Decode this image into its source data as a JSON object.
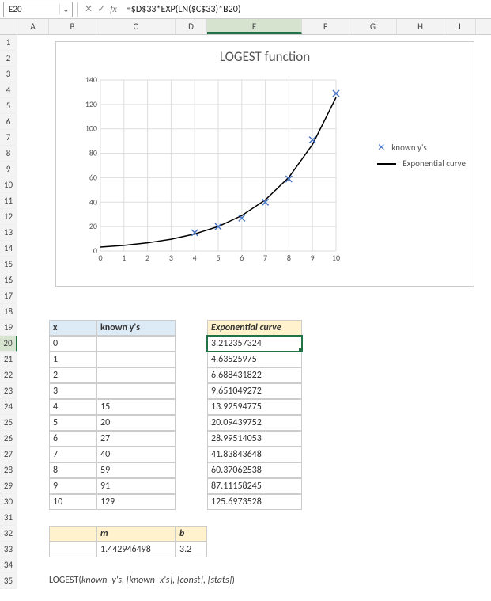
{
  "formula_bar": {
    "cell_ref": "E20",
    "formula": "=$D$33*EXP(LN($C$33)*B20)"
  },
  "columns": [
    "A",
    "B",
    "C",
    "D",
    "E",
    "F",
    "G",
    "H",
    "I"
  ],
  "column_widths": {
    "A": 40,
    "B": 60,
    "C": 100,
    "D": 40,
    "E": 120,
    "F": 60,
    "G": 60,
    "H": 60,
    "I": 40
  },
  "selected_column": "E",
  "selected_row": 20,
  "row_count": 35,
  "chart_data": {
    "type": "scatter+line",
    "title": "LOGEST function",
    "xlabel": "",
    "ylabel": "",
    "xlim": [
      0,
      10
    ],
    "ylim": [
      0,
      140
    ],
    "xticks": [
      0,
      1,
      2,
      3,
      4,
      5,
      6,
      7,
      8,
      9,
      10
    ],
    "yticks": [
      0,
      20,
      40,
      60,
      80,
      100,
      120,
      140
    ],
    "series": [
      {
        "name": "known y's",
        "type": "scatter",
        "marker": "x",
        "color": "#4472C4",
        "x": [
          4,
          5,
          6,
          7,
          8,
          9,
          10
        ],
        "y": [
          15,
          20,
          27,
          40,
          59,
          91,
          129
        ]
      },
      {
        "name": "Exponential curve",
        "type": "line",
        "color": "#000",
        "x": [
          0,
          1,
          2,
          3,
          4,
          5,
          6,
          7,
          8,
          9,
          10
        ],
        "y": [
          3.212357324,
          4.63525975,
          6.688431822,
          9.651049272,
          13.92594775,
          20.09439752,
          28.99514053,
          41.83843648,
          60.37062538,
          87.11158245,
          125.6973528
        ]
      }
    ],
    "legend_position": "right"
  },
  "table1": {
    "headers": {
      "x": "x",
      "ky": "known y's"
    },
    "rows": [
      {
        "x": "0",
        "ky": ""
      },
      {
        "x": "1",
        "ky": ""
      },
      {
        "x": "2",
        "ky": ""
      },
      {
        "x": "3",
        "ky": ""
      },
      {
        "x": "4",
        "ky": "15"
      },
      {
        "x": "5",
        "ky": "20"
      },
      {
        "x": "6",
        "ky": "27"
      },
      {
        "x": "7",
        "ky": "40"
      },
      {
        "x": "8",
        "ky": "59"
      },
      {
        "x": "9",
        "ky": "91"
      },
      {
        "x": "10",
        "ky": "129"
      }
    ]
  },
  "table2": {
    "header": "Exponential curve",
    "rows": [
      "3.212357324",
      "4.63525975",
      "6.688431822",
      "9.651049272",
      "13.92594775",
      "20.09439752",
      "28.99514053",
      "41.83843648",
      "60.37062538",
      "87.11158245",
      "125.6973528"
    ]
  },
  "table3": {
    "headers": {
      "m": "m",
      "b": "b"
    },
    "values": {
      "m": "1.442946498",
      "b": "3.2"
    }
  },
  "footer_formula": {
    "fn": "LOGEST(",
    "args": "known_y's, [known_x's], [const], [stats]",
    "close": ")"
  }
}
